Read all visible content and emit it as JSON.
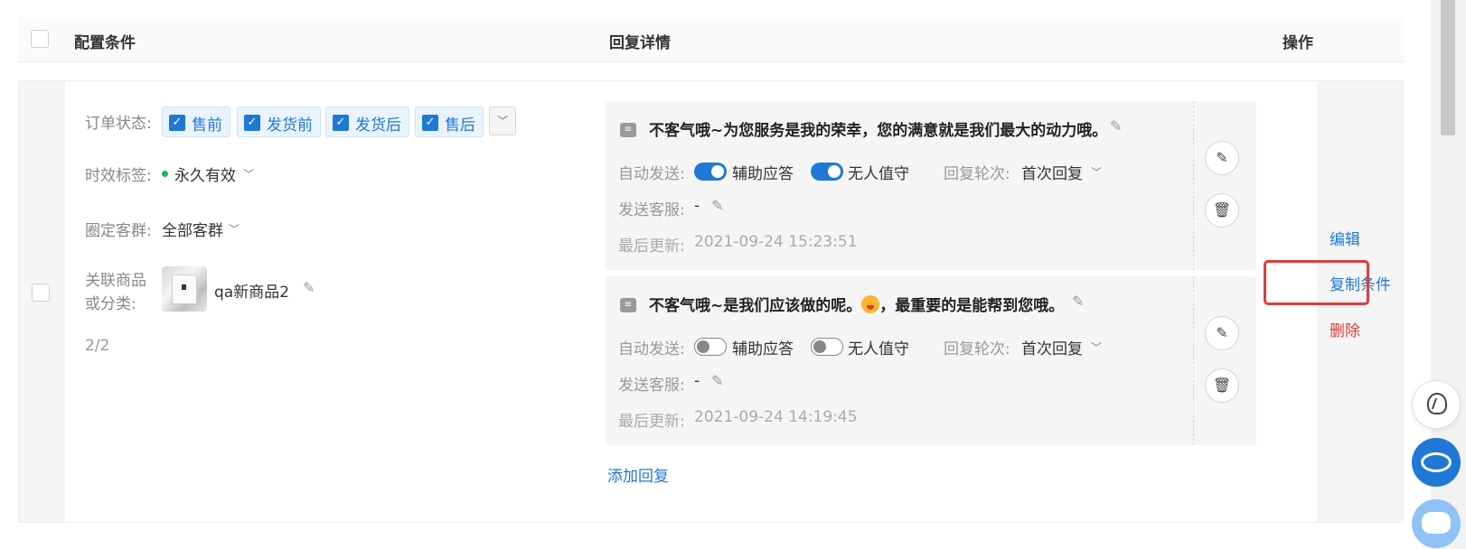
{
  "header": {
    "col_config": "配置条件",
    "col_reply": "回复详情",
    "col_actions": "操作"
  },
  "row": {
    "order_status_label": "订单状态:",
    "order_tags": [
      "售前",
      "发货前",
      "发货后",
      "售后"
    ],
    "validity_label": "时效标签:",
    "validity_value": "永久有效",
    "validity_dot_color": "#18b85c",
    "group_label": "圈定客群:",
    "group_value": "全部客群",
    "product_label_1": "关联商品",
    "product_label_2": "或分类:",
    "product_name": "qa新商品2",
    "count": "2/2",
    "add_reply": "添加回复",
    "actions": {
      "edit": "编辑",
      "copy": "复制条件",
      "delete": "删除"
    }
  },
  "replies": [
    {
      "message_before": "不客气哦~为您服务是我的荣幸，您的满意就是我们最大的动力哦。",
      "message_after": "",
      "has_emoji": false,
      "auto_send_label": "自动发送:",
      "assist_label": "辅助应答",
      "assist_on": true,
      "unmanned_label": "无人值守",
      "unmanned_on": true,
      "rounds_label": "回复轮次:",
      "rounds_value": "首次回复",
      "agent_label": "发送客服:",
      "agent_value": "-",
      "updated_label": "最后更新:",
      "updated_value": "2021-09-24 15:23:51"
    },
    {
      "message_before": "不客气哦~是我们应该做的呢。",
      "message_after": "，最重要的是能帮到您哦。",
      "has_emoji": true,
      "auto_send_label": "自动发送:",
      "assist_label": "辅助应答",
      "assist_on": false,
      "unmanned_label": "无人值守",
      "unmanned_on": false,
      "rounds_label": "回复轮次:",
      "rounds_value": "首次回复",
      "agent_label": "发送客服:",
      "agent_value": "-",
      "updated_label": "最后更新:",
      "updated_value": "2021-09-24 14:19:45"
    }
  ],
  "colors": {
    "accent": "#1f78d6",
    "danger": "#e23b3b",
    "highlight_border": "#e33b3b"
  }
}
